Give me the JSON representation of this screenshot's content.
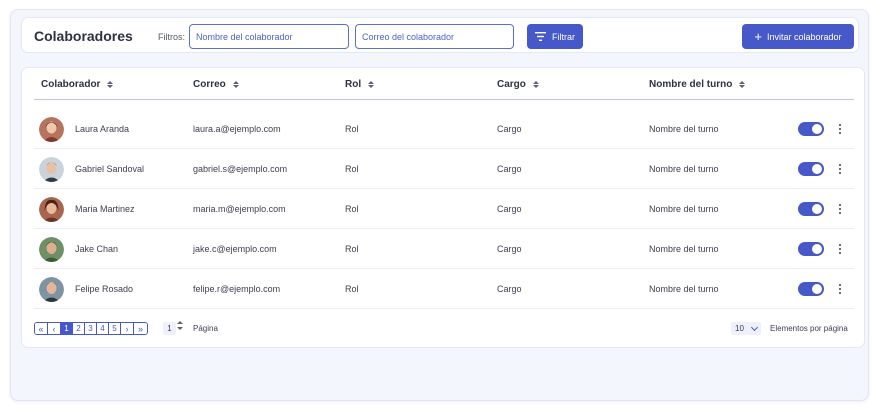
{
  "header": {
    "title": "Colaboradores",
    "filters_label": "Filtros:",
    "name_placeholder": "Nombre del colaborador",
    "email_placeholder": "Correo del colaborador",
    "filter_button": "Filtrar",
    "invite_button": "Invitar colaborador"
  },
  "table": {
    "columns": [
      "Colaborador",
      "Correo",
      "Rol",
      "Cargo",
      "Nombre del turno"
    ],
    "rows": [
      {
        "name": "Laura Aranda",
        "email": "laura.a@ejemplo.com",
        "role": "Rol",
        "position": "Cargo",
        "shift": "Nombre del turno",
        "active": true
      },
      {
        "name": "Gabriel Sandoval",
        "email": "gabriel.s@ejemplo.com",
        "role": "Rol",
        "position": "Cargo",
        "shift": "Nombre del turno",
        "active": true
      },
      {
        "name": "Maria Martinez",
        "email": "maria.m@ejemplo.com",
        "role": "Rol",
        "position": "Cargo",
        "shift": "Nombre del turno",
        "active": true
      },
      {
        "name": "Jake Chan",
        "email": "jake.c@ejemplo.com",
        "role": "Rol",
        "position": "Cargo",
        "shift": "Nombre del turno",
        "active": true
      },
      {
        "name": "Felipe Rosado",
        "email": "felipe.r@ejemplo.com",
        "role": "Rol",
        "position": "Cargo",
        "shift": "Nombre del turno",
        "active": true
      }
    ]
  },
  "pagination": {
    "pages": [
      "1",
      "2",
      "3",
      "4",
      "5"
    ],
    "current_page": "1",
    "page_label": "Página",
    "per_page": "10",
    "per_page_label": "Elementos por página"
  },
  "colors": {
    "accent": "#4759c9",
    "background": "#f3f6fd"
  }
}
